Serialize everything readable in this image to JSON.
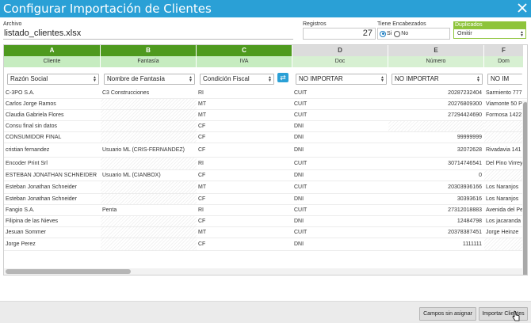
{
  "window": {
    "title": "Configurar Importación de Clientes",
    "close_icon": "close-icon"
  },
  "archivo": {
    "label": "Archivo",
    "value": "listado_clientes.xlsx"
  },
  "registros": {
    "label": "Registros",
    "value": "27"
  },
  "encabezados": {
    "label": "Tiene Encabezados",
    "options": [
      "Si",
      "No"
    ],
    "selected": "Si"
  },
  "duplicados": {
    "label": "Duplicados",
    "value": "Omitir",
    "accent": "#8ec43b"
  },
  "grid": {
    "letters": [
      "A",
      "B",
      "C",
      "D",
      "E",
      "F"
    ],
    "column_names": [
      "Cliente",
      "Fantasía",
      "IVA",
      "Doc",
      "Número",
      "Dom"
    ],
    "mappings": [
      "Razón Social",
      "Nombre de Fantasía",
      "Condición Fiscal",
      "NO IMPORTAR",
      "NO IMPORTAR",
      "NO IM"
    ],
    "swap_icon": "swap-arrows-icon",
    "rows": [
      [
        "C-3PO S.A.",
        "C3 Construcciones",
        "RI",
        "CUIT",
        "20287232404",
        "Sarmiento 777"
      ],
      [
        "Carlos Jorge Ramos",
        "",
        "MT",
        "CUIT",
        "20276809300",
        "Viamonte 50 P"
      ],
      [
        "Claudia Gabriela Flores",
        "",
        "MT",
        "CUIT",
        "27294424690",
        "Formosa 1422"
      ],
      [
        "Consu final sin datos",
        "",
        "CF",
        "DNI",
        "",
        ""
      ],
      [
        "CONSUMIDOR FINAL",
        "",
        "CF",
        "DNI",
        "99999999",
        ""
      ],
      [
        "cristian fernandez",
        "Usuario ML (CRIS-FERNANDEZ)",
        "CF",
        "DNI",
        "32072628",
        "Rivadavia 141"
      ],
      [
        "Encoder Print Srl",
        "",
        "RI",
        "CUIT",
        "30714746541",
        "Del Pino Virrey"
      ],
      [
        "ESTEBAN JONATHAN SCHNEIDER",
        "Usuario ML (CIANBOX)",
        "CF",
        "DNI",
        "0",
        ""
      ],
      [
        "Esteban Jonathan Schneider",
        "",
        "MT",
        "CUIT",
        "20303936166",
        "Los Naranjos"
      ],
      [
        "Esteban Jonathan Schneider",
        "",
        "CF",
        "DNI",
        "30393616",
        "Los Naranjos"
      ],
      [
        "Fangio S.A.",
        "Penta",
        "RI",
        "CUIT",
        "27312018883",
        "Avenida del Pe"
      ],
      [
        "Filipina de las Nieves",
        "",
        "CF",
        "DNI",
        "12484798",
        "Los jacaranda"
      ],
      [
        "Jesuan Sommer",
        "",
        "MT",
        "CUIT",
        "20378387451",
        "Jorge Heinze"
      ],
      [
        "Jorge Perez",
        "",
        "CF",
        "DNI",
        "1111111",
        ""
      ]
    ]
  },
  "footer": {
    "unassigned_label": "Campos sin asignar",
    "import_label": "Importar Clientes"
  }
}
